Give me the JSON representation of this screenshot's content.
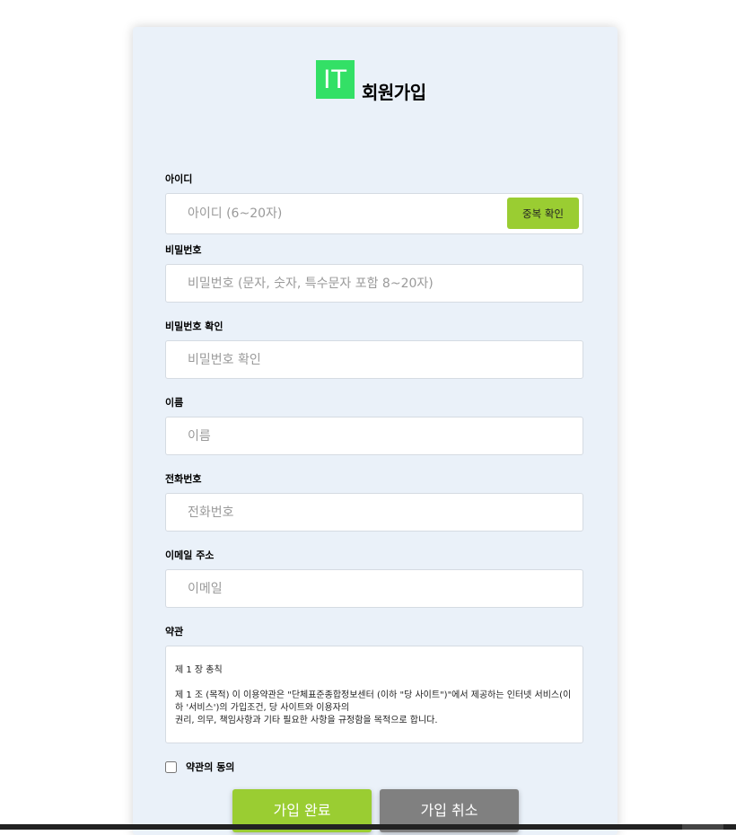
{
  "header": {
    "logo_text": "IT",
    "title": "회원가입"
  },
  "form": {
    "id": {
      "label": "아이디",
      "placeholder": "아이디 (6~20자)",
      "check_button": "중복 확인"
    },
    "password": {
      "label": "비밀번호",
      "placeholder": "비밀번호 (문자, 숫자, 특수문자 포함 8~20자)"
    },
    "password_confirm": {
      "label": "비밀번호 확인",
      "placeholder": "비밀번호 확인"
    },
    "name": {
      "label": "이름",
      "placeholder": "이름"
    },
    "phone": {
      "label": "전화번호",
      "placeholder": "전화번호"
    },
    "email": {
      "label": "이메일 주소",
      "placeholder": "이메일"
    },
    "terms": {
      "label": "약관",
      "chapter": "제 1 장 총칙",
      "article_line1": "제 1 조 (목적) 이 이용약관은 \"단체표준종합정보센터 (이하 \"당 사이트\")\"에서 제공하는 인터넷 서비스(이하 '서비스')의 가입조건, 당 사이트와 이용자의",
      "article_line2": "권리, 의무, 책임사항과 기타 필요한 사항을 규정함을 목적으로 합니다."
    },
    "agree": {
      "label": "약관의 동의",
      "checked": false
    }
  },
  "actions": {
    "submit_label": "가입 완료",
    "cancel_label": "가입 취소"
  },
  "colors": {
    "logo_green": "#33e066",
    "accent_green": "#9acd32",
    "cancel_gray": "#808080",
    "card_background": "#eaf1f9"
  }
}
